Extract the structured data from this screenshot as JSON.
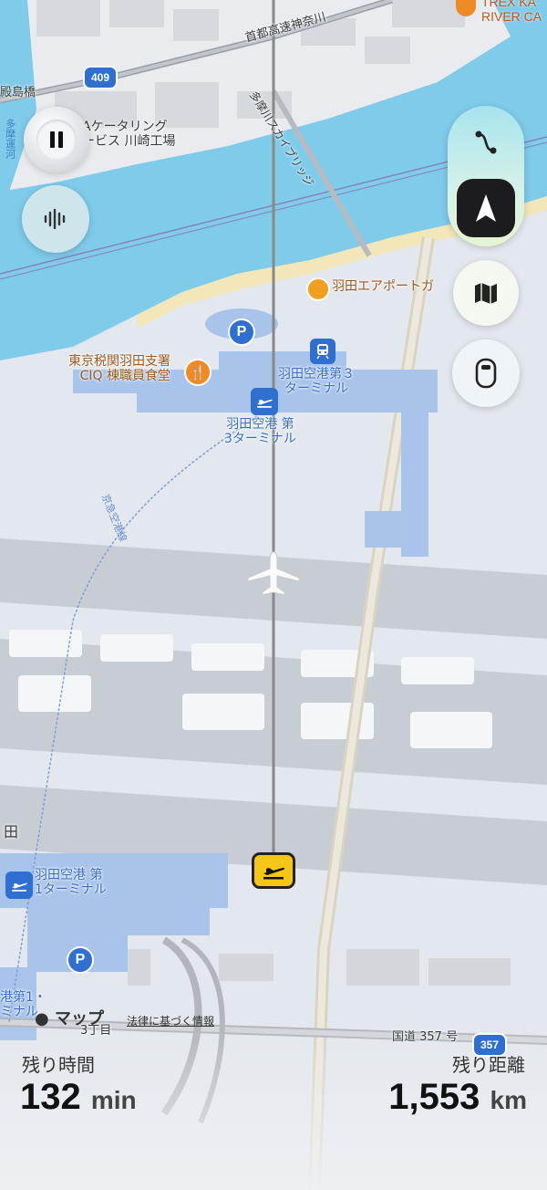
{
  "map_labels": {
    "expressway": "首都高速神奈川",
    "route_409": "409",
    "bridge_left": "殿島橋",
    "catering": "Aケータリング\nービス 川崎工場",
    "canal": "多摩運河",
    "skybridge": "多摩川スカイブリッジ",
    "river_cafe": "TREX KA\nRIVER CA",
    "airport_garden": "羽田エアポートガ",
    "customs": "東京税関羽田支署\nCIQ 棟職員食堂",
    "station_t3": "羽田空港第３\nターミナル",
    "terminal3": "羽田空港 第\n3ターミナル",
    "keikyu_line": "京急空港線",
    "haneda_kanji": "田",
    "terminal1": "羽田空港 第\n1ターミナル",
    "station_t1": "港第1・\nミナル",
    "chome": "3丁目",
    "route_357_text": "国道 357 号",
    "route_357_shield": "357"
  },
  "attribution": {
    "maps_logo": " マップ",
    "legal": "法律に基づく情報"
  },
  "trip": {
    "time_label": "残り時間",
    "time_value": "132",
    "time_unit": "min",
    "distance_label": "残り距離",
    "distance_value": "1,553",
    "distance_unit": "km"
  },
  "icons": {
    "pause": "pause-icon",
    "audio": "waveform-icon",
    "route": "route-icon",
    "compass": "location-arrow-icon",
    "map": "map-icon",
    "window": "airplane-window-icon",
    "plane": "airplane-icon",
    "departure": "departure-icon"
  },
  "colors": {
    "water": "#7ecbea",
    "land": "#e3e8ee",
    "runway": "#c8cdd4",
    "terminal": "#a8c4ea",
    "accent_dark": "#1c1c1e",
    "badge_yellow": "#f5c518"
  }
}
